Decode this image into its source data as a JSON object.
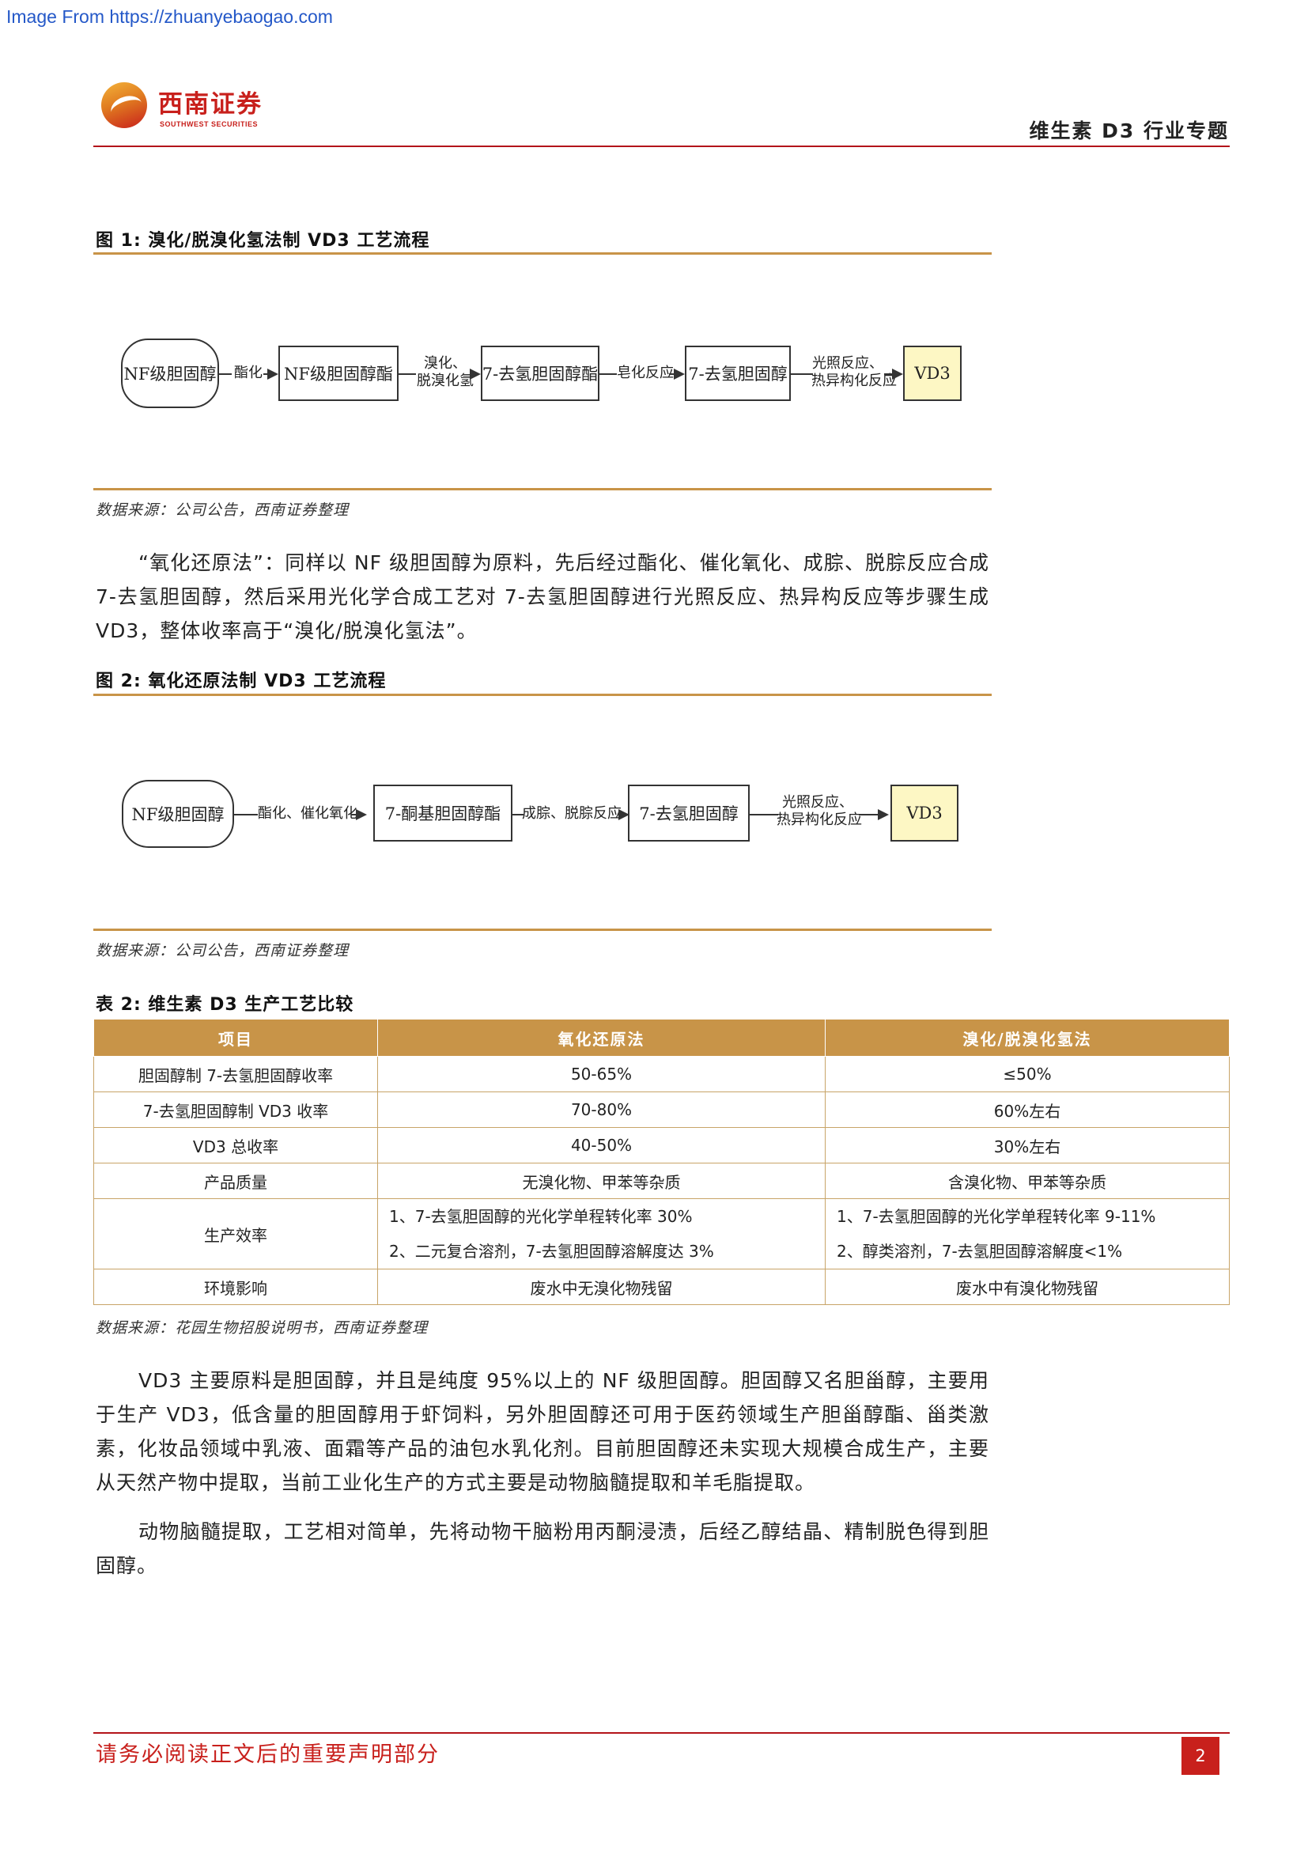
{
  "watermark": "Image From https://zhuanyebaogao.com",
  "header": {
    "logo_cn": "西南证券",
    "logo_en": "SOUTHWEST SECURITIES",
    "title": "维生素 D3 行业专题"
  },
  "figure1": {
    "title": "图 1:  溴化/脱溴化氢法制 VD3 工艺流程",
    "source": "数据来源：公司公告，西南证券整理",
    "nodes": [
      "NF级胆固醇",
      "NF级胆固醇酯",
      "7-去氢胆固醇酯",
      "7-去氢胆固醇",
      "VD3"
    ],
    "edges": [
      [
        "酯化"
      ],
      [
        "溴化、",
        "脱溴化氢"
      ],
      [
        "皂化反应"
      ],
      [
        "光照反应、",
        "热异构化反应"
      ]
    ]
  },
  "paragraph1": "“氧化还原法”：同样以 NF 级胆固醇为原料，先后经过酯化、催化氧化、成腙、脱腙反应合成 7-去氢胆固醇，然后采用光化学合成工艺对 7-去氢胆固醇进行光照反应、热异构反应等步骤生成 VD3，整体收率高于“溴化/脱溴化氢法”。",
  "figure2": {
    "title": "图 2:  氧化还原法制 VD3 工艺流程",
    "source": "数据来源：公司公告，西南证券整理",
    "nodes": [
      "NF级胆固醇",
      "7-酮基胆固醇酯",
      "7-去氢胆固醇",
      "VD3"
    ],
    "edges": [
      [
        "酯化、催化氧化"
      ],
      [
        "成腙、脱腙反应"
      ],
      [
        "光照反应、",
        "热异构化反应"
      ]
    ]
  },
  "table2": {
    "title": "表 2:  维生素 D3 生产工艺比较",
    "headers": [
      "项目",
      "氧化还原法",
      "溴化/脱溴化氢法"
    ],
    "rows": [
      {
        "item": "胆固醇制 7-去氢胆固醇收率",
        "a": "50-65%",
        "b": "≤50%"
      },
      {
        "item": "7-去氢胆固醇制 VD3 收率",
        "a": "70-80%",
        "b": "60%左右"
      },
      {
        "item": "VD3 总收率",
        "a": "40-50%",
        "b": "30%左右"
      },
      {
        "item": "产品质量",
        "a": "无溴化物、甲苯等杂质",
        "b": "含溴化物、甲苯等杂质"
      },
      {
        "item": "生产效率",
        "a1": "1、7-去氢胆固醇的光化学单程转化率 30%",
        "a2": "2、二元复合溶剂，7-去氢胆固醇溶解度达 3%",
        "b1": "1、7-去氢胆固醇的光化学单程转化率 9-11%",
        "b2": "2、醇类溶剂，7-去氢胆固醇溶解度<1%"
      },
      {
        "item": "环境影响",
        "a": "废水中无溴化物残留",
        "b": "废水中有溴化物残留"
      }
    ],
    "source": "数据来源：花园生物招股说明书，西南证券整理"
  },
  "paragraph2": "VD3 主要原料是胆固醇，并且是纯度 95%以上的 NF 级胆固醇。胆固醇又名胆甾醇，主要用于生产 VD3，低含量的胆固醇用于虾饲料，另外胆固醇还可用于医药领域生产胆甾醇酯、甾类激素，化妆品领域中乳液、面霜等产品的油包水乳化剂。目前胆固醇还未实现大规模合成生产，主要从天然产物中提取，当前工业化生产的方式主要是动物脑髓提取和羊毛脂提取。",
  "paragraph3": "动物脑髓提取，工艺相对简单，先将动物干脑粉用丙酮浸渍，后经乙醇结晶、精制脱色得到胆固醇。",
  "footer": {
    "notice": "请务必阅读正文后的重要声明部分",
    "page": "2"
  }
}
